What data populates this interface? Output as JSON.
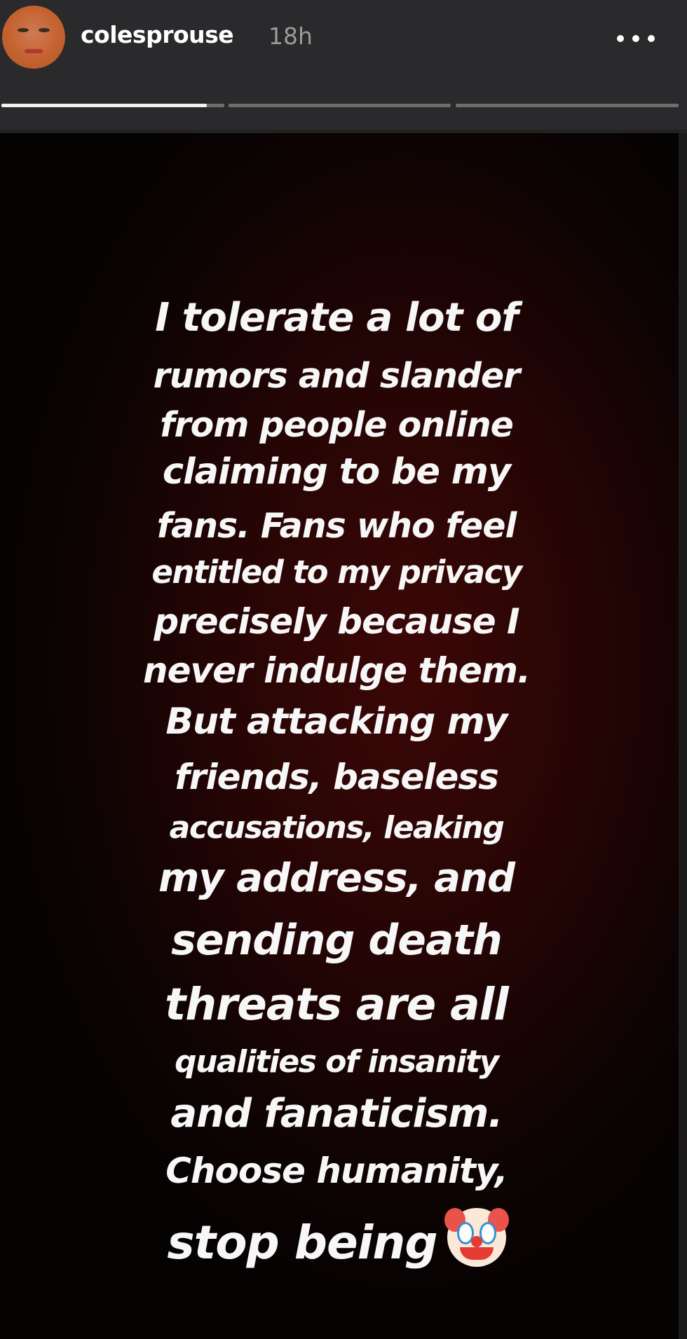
{
  "header": {
    "username": "colesprouse",
    "timestamp": "18h",
    "more_icon": "more-horizontal-icon",
    "progress": [
      {
        "segment": 1,
        "fill": 0.92
      },
      {
        "segment": 2,
        "fill": 0
      },
      {
        "segment": 3,
        "fill": 0
      }
    ]
  },
  "story": {
    "lines": [
      "I tolerate a lot of",
      "rumors and slander",
      "from people online",
      "claiming to be my",
      "fans. Fans who feel",
      "entitled to my privacy",
      "precisely because I",
      "never indulge them.",
      "But attacking my",
      "friends, baseless",
      "accusations, leaking",
      "my address, and",
      "sending death",
      "threats are all",
      "qualities of insanity",
      "and fanaticism.",
      "Choose humanity,",
      "stop being"
    ],
    "emoji": "clown-face-icon",
    "colors": {
      "background_center": "#3c0706",
      "background_edge": "#050202",
      "text": "#f7f7f7"
    }
  }
}
